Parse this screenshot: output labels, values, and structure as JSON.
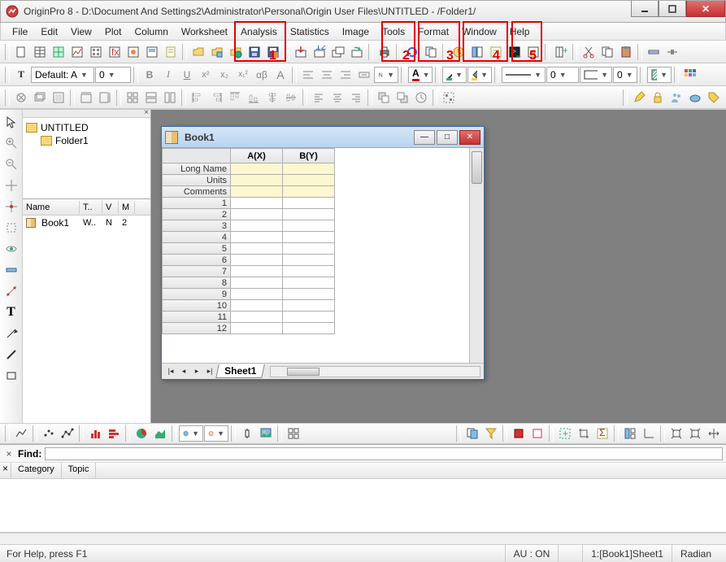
{
  "window": {
    "title": "OriginPro 8 - D:\\Document And Settings2\\Administrator\\Personal\\Origin User Files\\UNTITLED - /Folder1/"
  },
  "menu": {
    "items": [
      "File",
      "Edit",
      "View",
      "Plot",
      "Column",
      "Worksheet",
      "Analysis",
      "Statistics",
      "Image",
      "Tools",
      "Format",
      "Window",
      "Help"
    ]
  },
  "annotations": [
    "1",
    "2",
    "3",
    "4",
    "5"
  ],
  "font_combo": {
    "label": "Default: A",
    "size": "0"
  },
  "style_buttons": {
    "bold": "B",
    "italic": "I",
    "underline": "U",
    "xexp": "x²",
    "xsub1": "x₂",
    "xsub2": "x₁²",
    "ab": "αβ",
    "A": "A",
    "Abig": "A"
  },
  "project": {
    "root": "UNTITLED",
    "folder": "Folder1",
    "grid_headers": [
      "Name",
      "T..",
      "V",
      "M"
    ],
    "grid_row": {
      "name": "Book1",
      "c2": "W..",
      "c3": "N",
      "c4": "2"
    }
  },
  "book": {
    "title": "Book1",
    "col_headers": [
      "A(X)",
      "B(Y)"
    ],
    "row_labels": [
      "Long Name",
      "Units",
      "Comments"
    ],
    "row_numbers": [
      "1",
      "2",
      "3",
      "4",
      "5",
      "6",
      "7",
      "8",
      "9",
      "10",
      "11",
      "12"
    ],
    "sheet_tab": "Sheet1"
  },
  "find": {
    "label": "Find:",
    "value": "",
    "tabs": [
      "Category",
      "Topic"
    ]
  },
  "status": {
    "help": "For Help, press F1",
    "au": "AU : ON",
    "loc": "1:[Book1]Sheet1",
    "angle": "Radian"
  },
  "left_tool_letter": "T"
}
